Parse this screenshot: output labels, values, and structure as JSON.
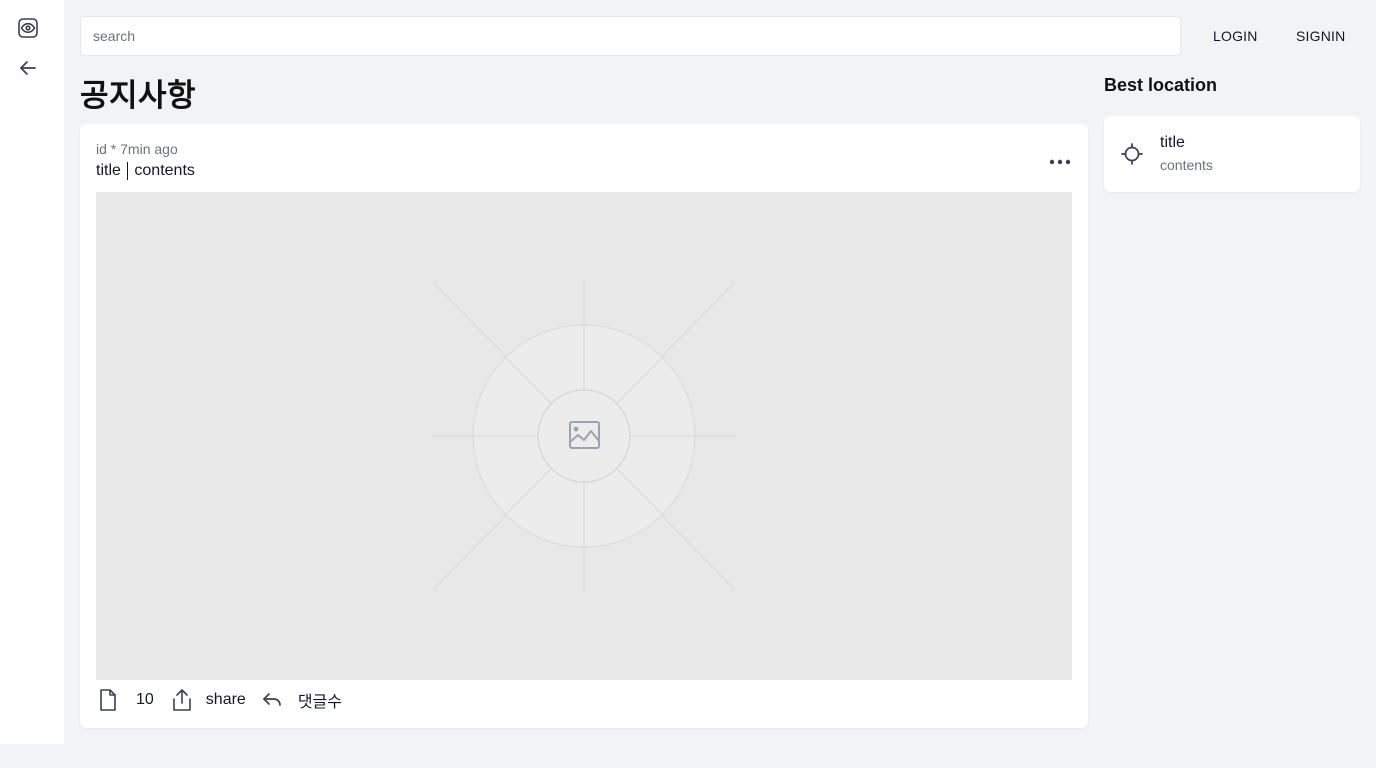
{
  "sidebar": {
    "icons": [
      "eye-icon",
      "arrow-left-icon"
    ]
  },
  "header": {
    "search_placeholder": "search",
    "login_label": "LOGIN",
    "signin_label": "SIGNIN"
  },
  "page": {
    "title": "공지사항"
  },
  "post": {
    "author_id": "id",
    "meta_sep": "*",
    "time_ago": "7min ago",
    "title": "title",
    "contents": "contents",
    "image_placeholder_icon": "image-icon",
    "more_icon": "more-horizontal-icon",
    "actions": {
      "doc_icon": "document-icon",
      "count": "10",
      "share_icon": "share-icon",
      "share_label": "share",
      "reply_icon": "reply-icon",
      "comment_label": "댓글수"
    }
  },
  "aside": {
    "title": "Best location",
    "items": [
      {
        "icon": "crosshair-icon",
        "title": "title",
        "subtitle": "contents"
      }
    ]
  },
  "colors": {
    "background": "#f2f3f5",
    "surface": "#ffffff",
    "muted_text": "#6b7280",
    "placeholder_bg": "#e8e8e8"
  }
}
